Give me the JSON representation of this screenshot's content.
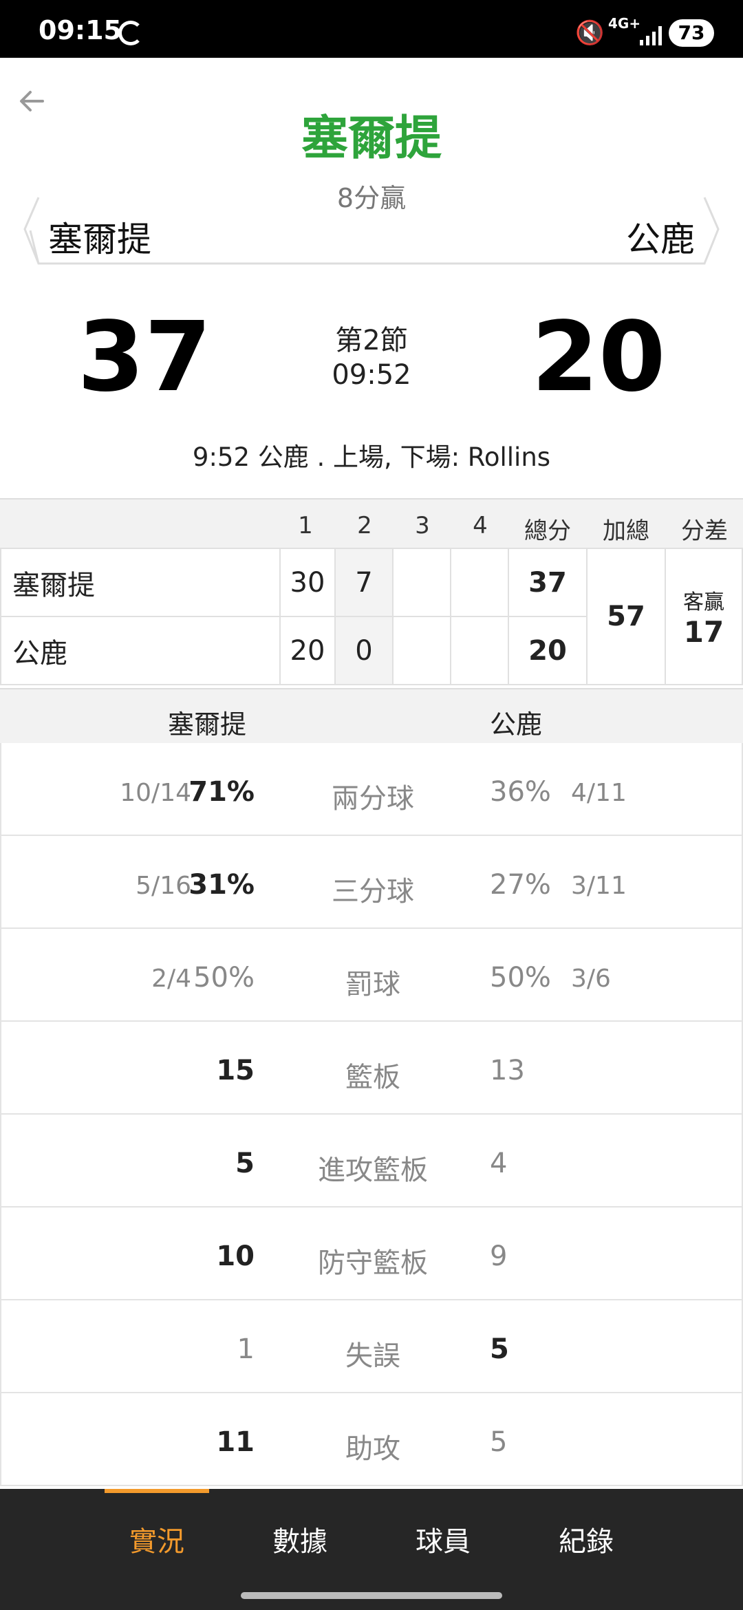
{
  "status_bar": {
    "time": "09:15",
    "network": "4G+",
    "battery": "73"
  },
  "header": {
    "winner": "塞爾提",
    "margin": "8分贏",
    "home_team": "塞爾提",
    "away_team": "公鹿"
  },
  "score": {
    "home": "37",
    "away": "20",
    "period": "第2節",
    "clock": "09:52"
  },
  "last_play": "9:52 公鹿 . 上場, 下場: Rollins",
  "quarter_table": {
    "headers": [
      "1",
      "2",
      "3",
      "4",
      "總分",
      "加總",
      "分差"
    ],
    "rows": [
      {
        "team": "塞爾提",
        "q1": "30",
        "q2": "7",
        "q3": "",
        "q4": "",
        "total": "37"
      },
      {
        "team": "公鹿",
        "q1": "20",
        "q2": "0",
        "q3": "",
        "q4": "",
        "total": "20"
      }
    ],
    "sum": "57",
    "diff_label": "客贏",
    "diff_value": "17"
  },
  "stats": {
    "home_team": "塞爾提",
    "away_team": "公鹿",
    "rows": [
      {
        "label": "兩分球",
        "home_frac": "10/14",
        "home_val": "71%",
        "away_val": "36%",
        "away_frac": "4/11",
        "leader": "home"
      },
      {
        "label": "三分球",
        "home_frac": "5/16",
        "home_val": "31%",
        "away_val": "27%",
        "away_frac": "3/11",
        "leader": "home"
      },
      {
        "label": "罰球",
        "home_frac": "2/4",
        "home_val": "50%",
        "away_val": "50%",
        "away_frac": "3/6",
        "leader": "none"
      },
      {
        "label": "籃板",
        "home_frac": "",
        "home_val": "15",
        "away_val": "13",
        "away_frac": "",
        "leader": "home"
      },
      {
        "label": "進攻籃板",
        "home_frac": "",
        "home_val": "5",
        "away_val": "4",
        "away_frac": "",
        "leader": "home"
      },
      {
        "label": "防守籃板",
        "home_frac": "",
        "home_val": "10",
        "away_val": "9",
        "away_frac": "",
        "leader": "home"
      },
      {
        "label": "失誤",
        "home_frac": "",
        "home_val": "1",
        "away_val": "5",
        "away_frac": "",
        "leader": "away"
      },
      {
        "label": "助攻",
        "home_frac": "",
        "home_val": "11",
        "away_val": "5",
        "away_frac": "",
        "leader": "home"
      }
    ]
  },
  "nav": {
    "tabs": [
      "實況",
      "數據",
      "球員",
      "紀錄"
    ],
    "active": "實況"
  },
  "colors": {
    "winner_green": "#2ea43b",
    "accent_orange": "#f39a2c",
    "nav_bg": "#262626"
  }
}
